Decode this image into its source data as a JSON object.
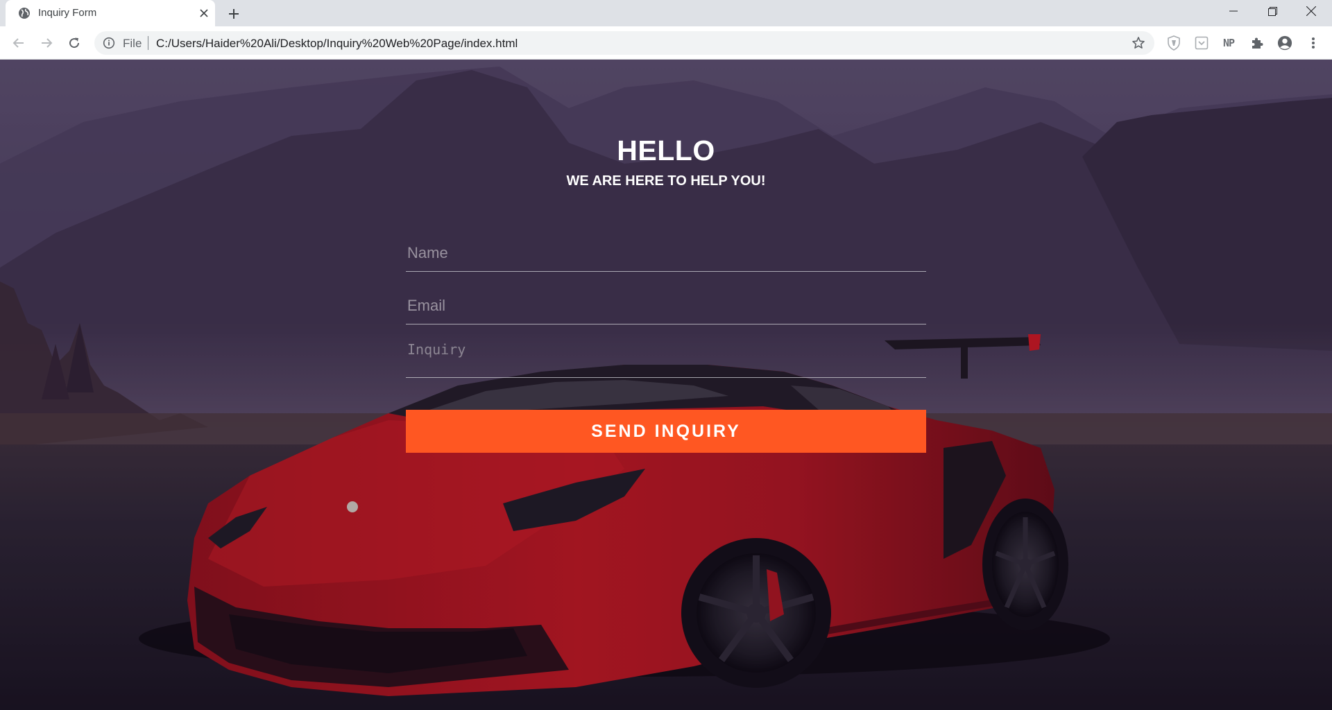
{
  "browser": {
    "tab_title": "Inquiry Form",
    "url_scheme": "File",
    "url": "C:/Users/Haider%20Ali/Desktop/Inquiry%20Web%20Page/index.html",
    "extension_np_label": "NP"
  },
  "page": {
    "title": "HELLO",
    "subtitle": "WE ARE HERE TO HELP YOU!",
    "form": {
      "name_placeholder": "Name",
      "email_placeholder": "Email",
      "inquiry_placeholder": "Inquiry",
      "submit_label": "SEND INQUIRY"
    }
  },
  "colors": {
    "accent": "#ff5722",
    "car": "#c4161c",
    "chrome_tabstrip": "#dee1e6"
  }
}
